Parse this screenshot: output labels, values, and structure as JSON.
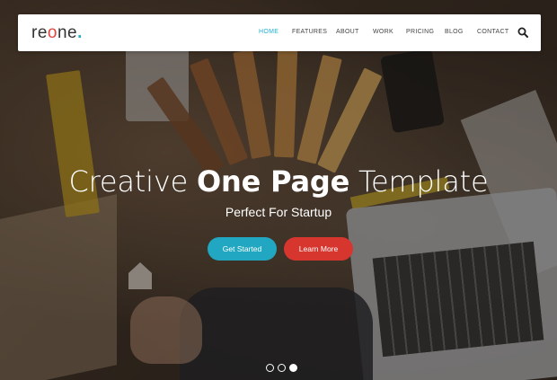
{
  "brand": {
    "logo_pre": "re",
    "logo_o": "o",
    "logo_post": "ne",
    "logo_dot": "."
  },
  "nav": {
    "items": [
      {
        "label": "HOME",
        "active": true
      },
      {
        "label": "FEATURES",
        "active": false
      },
      {
        "label": "ABOUT",
        "active": false
      },
      {
        "label": "WORK",
        "active": false
      },
      {
        "label": "PRICING",
        "active": false
      },
      {
        "label": "BLOG",
        "active": false
      },
      {
        "label": "CONTACT",
        "active": false
      }
    ],
    "search_icon": "search-icon"
  },
  "hero": {
    "headline_light_1": "Creative ",
    "headline_bold": "One Page",
    "headline_light_2": " Template",
    "subline": "Perfect For Startup",
    "primary_button": "Get Started",
    "secondary_button": "Learn More"
  },
  "slider": {
    "slide_count": 3,
    "active_slide": 3
  },
  "colors": {
    "accent_teal": "#21a7c1",
    "accent_red": "#d7362f",
    "nav_active": "#22b2cc",
    "logo_o": "#e2463e"
  }
}
